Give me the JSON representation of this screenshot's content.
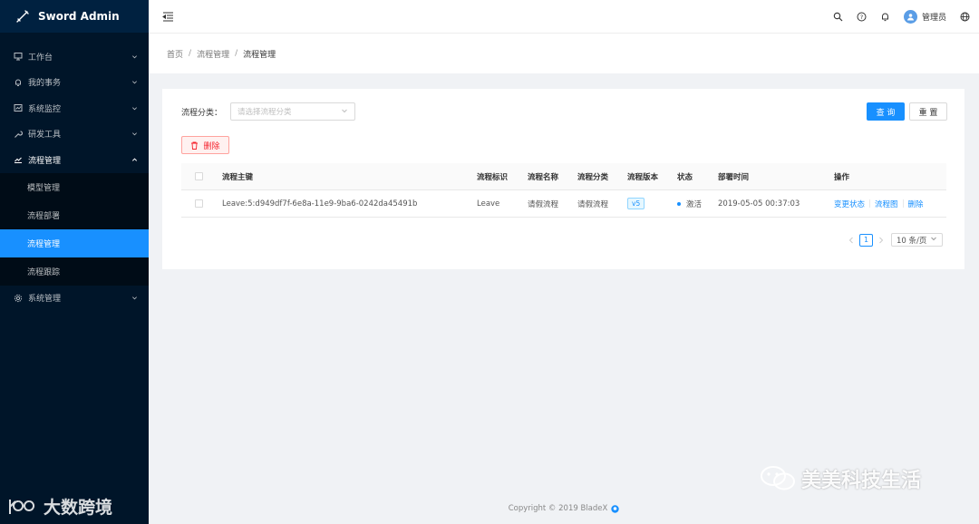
{
  "brand": {
    "title": "Sword Admin"
  },
  "sidebar": {
    "items": [
      {
        "label": "工作台",
        "icon": "monitor-icon"
      },
      {
        "label": "我的事务",
        "icon": "bell-icon"
      },
      {
        "label": "系统监控",
        "icon": "dashboard-icon"
      },
      {
        "label": "研发工具",
        "icon": "tool-icon"
      },
      {
        "label": "流程管理",
        "icon": "line-chart-icon"
      },
      {
        "label": "系统管理",
        "icon": "setting-icon"
      }
    ],
    "submenu": [
      {
        "label": "模型管理"
      },
      {
        "label": "流程部署"
      },
      {
        "label": "流程管理"
      },
      {
        "label": "流程跟踪"
      }
    ],
    "watermark": "大数跨境"
  },
  "header": {
    "user": "管理员"
  },
  "breadcrumb": {
    "home": "首页",
    "level1": "流程管理",
    "current": "流程管理",
    "sep": "/"
  },
  "search": {
    "label": "流程分类：",
    "placeholder": "请选择流程分类"
  },
  "buttons": {
    "query": "查 询",
    "reset": "重 置",
    "delete": "删除"
  },
  "table": {
    "columns": [
      "流程主键",
      "流程标识",
      "流程名称",
      "流程分类",
      "流程版本",
      "状态",
      "部署时间",
      "操作"
    ],
    "rows": [
      {
        "id": "Leave:5:d949df7f-6e8a-11e9-9ba6-0242da45491b",
        "key": "Leave",
        "name": "请假流程",
        "category": "请假流程",
        "version": "v5",
        "status": "激活",
        "deploy_time": "2019-05-05 00:37:03",
        "ops": [
          "变更状态",
          "流程图",
          "删除"
        ]
      }
    ]
  },
  "pagination": {
    "current_page": "1",
    "page_size": "10 条/页"
  },
  "footer": {
    "text": "Copyright © 2019 BladeX"
  },
  "watermark": {
    "text": "美美科技生活"
  },
  "colors": {
    "primary": "#1890ff",
    "sidebar": "#001529",
    "danger": "#f5222d"
  }
}
